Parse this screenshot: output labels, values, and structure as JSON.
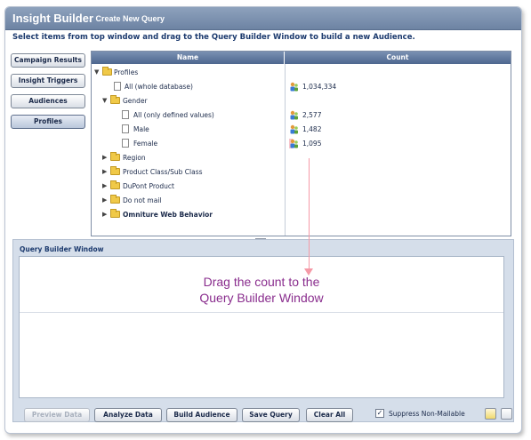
{
  "window": {
    "app_title": "Insight Builder",
    "crumb_sep": "›",
    "page_title": "Create New Query"
  },
  "instructions": "Select items from top window and drag to the Query Builder Window to build a new Audience.",
  "sidenav": {
    "items": [
      {
        "label": "Campaign Results",
        "active": false
      },
      {
        "label": "Insight Triggers",
        "active": false
      },
      {
        "label": "Audiences",
        "active": false
      },
      {
        "label": "Profiles",
        "active": true
      }
    ]
  },
  "tree": {
    "columns": {
      "name": "Name",
      "count": "Count"
    },
    "rows": [
      {
        "label": "Profiles",
        "count": ""
      },
      {
        "label": "All (whole database)",
        "count": "1,034,334"
      },
      {
        "label": "Gender",
        "count": ""
      },
      {
        "label": "All (only defined values)",
        "count": "2,577"
      },
      {
        "label": "Male",
        "count": "1,482"
      },
      {
        "label": "Female",
        "count": "1,095"
      },
      {
        "label": "Region",
        "count": ""
      },
      {
        "label": "Product Class/Sub Class",
        "count": ""
      },
      {
        "label": "DuPont Product",
        "count": ""
      },
      {
        "label": "Do not mail",
        "count": ""
      },
      {
        "label": "Omniture Web Behavior",
        "count": ""
      }
    ]
  },
  "query_builder": {
    "title": "Query Builder Window",
    "hint_line1": "Drag the count to the",
    "hint_line2": "Query Builder Window"
  },
  "toolbar": {
    "preview_label": "Preview Data",
    "analyze_label": "Analyze Data",
    "build_label": "Build Audience",
    "save_label": "Save Query",
    "clear_label": "Clear All",
    "suppress_label": "Suppress Non-Mailable",
    "suppress_checked": true,
    "check_mark": "✓"
  },
  "colors": {
    "title_bar": "#6d83a3",
    "accent": "#1c3a6e",
    "hint": "#8a2e8e",
    "highlight": "#f7c5cc",
    "arrow": "#f59aa7"
  }
}
